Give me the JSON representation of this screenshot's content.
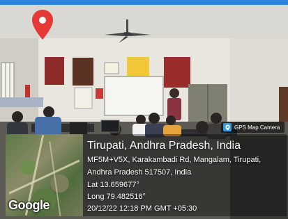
{
  "badge": {
    "label": "GPS Map Camera",
    "icon": "gps-camera-icon"
  },
  "map": {
    "provider_logo": "Google",
    "marker_icon": "location-pin-icon",
    "marker_color": "#e53935"
  },
  "location": {
    "title": "Tirupati, Andhra Pradesh, India",
    "address_line1": "MF5M+V5X, Karakambadi Rd, Mangalam, Tirupati,",
    "address_line2": "Andhra Pradesh 517507, India",
    "latitude": "Lat 13.659677°",
    "longitude": "Long 79.482516°",
    "datetime": "20/12/22 12:18 PM GMT +05:30"
  },
  "colors": {
    "frame_accent": "#2f88d8",
    "overlay": "rgba(0,0,0,0.38)",
    "text": "#ffffff"
  }
}
